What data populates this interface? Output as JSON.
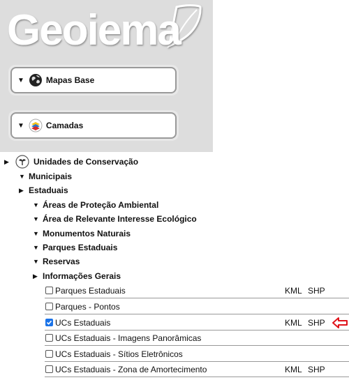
{
  "logo": {
    "text": "Geoiema"
  },
  "panels": {
    "base_maps": {
      "label": "Mapas Base"
    },
    "layers": {
      "label": "Camadas"
    }
  },
  "tree": {
    "root": "Unidades de Conservação",
    "municipal": "Municipais",
    "state": "Estaduais",
    "groups": [
      "Áreas de Proteção Ambiental",
      "Área de Relevante Interesse Ecológico",
      "Monumentos Naturais",
      "Parques Estaduais",
      "Reservas"
    ],
    "general_info": "Informações Gerais"
  },
  "layers": [
    {
      "label": "Parques Estaduais",
      "checked": false,
      "kml": "KML",
      "shp": "SHP"
    },
    {
      "label": "Parques - Pontos",
      "checked": false
    },
    {
      "label": "UCs Estaduais",
      "checked": true,
      "kml": "KML",
      "shp": "SHP"
    },
    {
      "label": "UCs Estaduais - Imagens Panorâmicas",
      "checked": false
    },
    {
      "label": "UCs Estaduais - Sítios Eletrônicos",
      "checked": false
    },
    {
      "label": "UCs Estaduais - Zona de Amortecimento",
      "checked": false,
      "kml": "KML",
      "shp": "SHP"
    }
  ],
  "colors": {
    "pointer": "#e0131a",
    "checkbox": "#1a73e8"
  }
}
